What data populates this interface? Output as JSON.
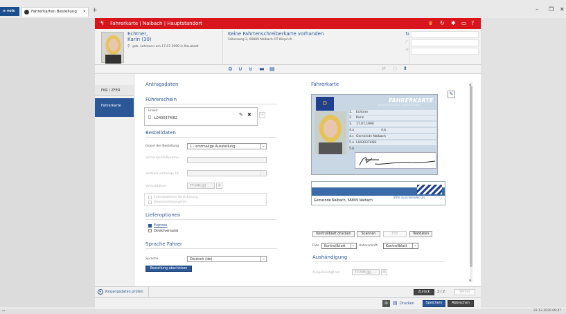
{
  "browser": {
    "logo": "≡ vois",
    "tab_title": "Fahrerkarten Bestellung",
    "new_tab": "+",
    "min": "–",
    "restore": "❐",
    "close": "✕"
  },
  "header": {
    "title": "Fahrerkarte | Nalbach | Hauptstandort",
    "name": "Echtner,",
    "firstname_age": "Karin (30)",
    "birth": "geb. Lehmann am 17.07.1990 in Neustadt",
    "notice": "Keine Fahrtenschreiberkarte vorhanden",
    "address": "Falkenweg 2, 66809 Nalbach OT Körprich"
  },
  "sidebar": {
    "items": [
      {
        "label": "FKR / ZFER"
      },
      {
        "label": "Fahrerkarte"
      }
    ]
  },
  "antrag": {
    "title": "Antragsdaten",
    "fuehrerschein_title": "Führerschein",
    "erteilt_label": "Erteilt",
    "erteilt_value": "L0430374I82",
    "bestelldaten_title": "Bestelldaten",
    "grund_label": "Grund der Bestellung",
    "grund_value": "1 - erstmalige Ausstellung",
    "vorherige_label": "Vorherige FK-Nummer",
    "verbleib_label": "Verbleib vorherige FK",
    "verlust_label": "Verlustdatum",
    "verlust_placeholder": "TT.MM.JJJJ",
    "eid_label": "Eidesstattliche Versicherung",
    "gewalt_label": "Gewahrsleistungsfall",
    "liefer_title": "Lieferoptionen",
    "express_label": "Express",
    "direkt_label": "Direktversand",
    "sprache_title": "Sprache Fahrer",
    "sprache_label": "Sprache",
    "sprache_value": "Deutsch (de)",
    "submit_label": "Bestellung abschicken"
  },
  "fahrerkarte": {
    "title": "Fahrerkarte",
    "card_title": "FAHRERKARTE",
    "card_subtitle": "BUNDESREPUBLIK DEUTSCHLAND",
    "country": "D",
    "fields": [
      {
        "no": "1.",
        "val": "Echtner"
      },
      {
        "no": "2.",
        "val": "Karin"
      },
      {
        "no": "3.",
        "val": "17.07.1990"
      },
      {
        "no": "4.a",
        "val": ""
      },
      {
        "no": "4.c",
        "val": "Gemeinde Nalbach"
      },
      {
        "no": "5.a",
        "val": "L0430374I82"
      },
      {
        "no": "5.b",
        "val": ""
      }
    ],
    "field_4b": "4.b",
    "back_label": "Bitte zurücksenden an:",
    "back_address": "Gemeinde Nalbach, 66809 Nalbach",
    "btn_kontrollblatt": "Kontrollblatt drucken",
    "btn_scannen": "Scannen",
    "btn_edit": "Edit",
    "btn_testdaten": "Testdaten",
    "foto_label": "Foto",
    "foto_value": "Kontrollblatt",
    "unterschrift_label": "Unterschrift",
    "unterschrift_value": "Kontrollblatt",
    "aushaendigung_title": "Aushändigung",
    "ausgehaendigt_label": "Ausgehändigt am",
    "ausgehaendigt_placeholder": "TT.MM.JJJJ"
  },
  "footer": {
    "pruefen": "Vorgangsdaten prüfen",
    "zurueck": "Zurück",
    "page": "2 / 2",
    "weiter": "Weiter",
    "drucken": "Drucken",
    "speichern": "Speichern",
    "abbrechen": "Abbrechen"
  },
  "status": {
    "datetime": "22.12.2020 09:47"
  },
  "colors": {
    "accent": "#2b5797",
    "header_red": "#d8141c"
  }
}
